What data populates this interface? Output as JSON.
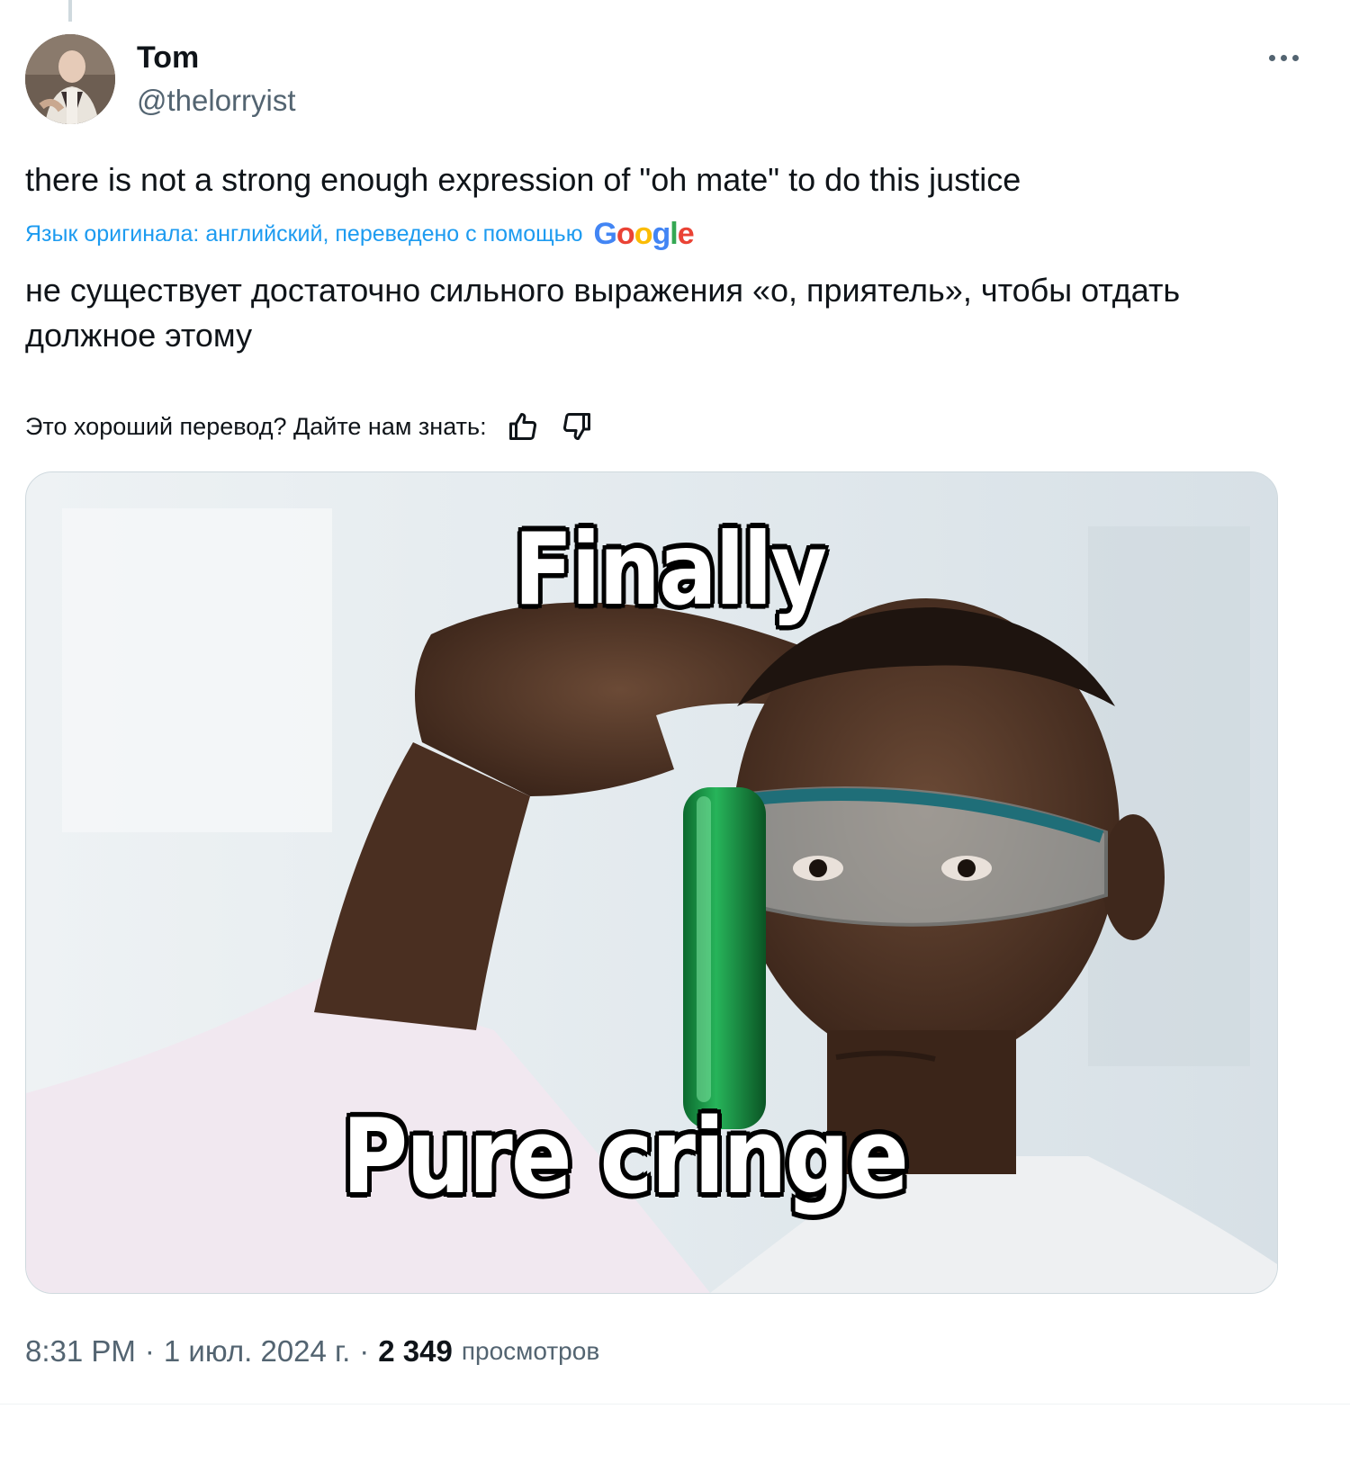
{
  "author": {
    "display_name": "Tom",
    "handle": "@thelorryist"
  },
  "tweet": {
    "text": "there is not a strong enough expression of \"oh mate\" to do this justice",
    "translation_note": "Язык оригинала: английский, переведено с помощью",
    "translation_provider": "Google",
    "translated_text": "не существует достаточно сильного выражения «о, приятель», чтобы отдать должное этому",
    "feedback_prompt": "Это хороший перевод? Дайте нам знать:"
  },
  "media": {
    "caption_top": "Finally",
    "caption_bottom": "Pure cringe"
  },
  "meta": {
    "time": "8:31 PM",
    "separator": "·",
    "date": "1 июл. 2024 г.",
    "views_count": "2 349",
    "views_label": "просмотров"
  },
  "colors": {
    "accent": "#1d9bf0",
    "secondary_text": "#536471",
    "primary_text": "#0f1419",
    "border": "#cfd9de"
  },
  "icons": {
    "more": "more-horizontal-icon",
    "thumbs_up": "thumbs-up-icon",
    "thumbs_down": "thumbs-down-icon"
  }
}
